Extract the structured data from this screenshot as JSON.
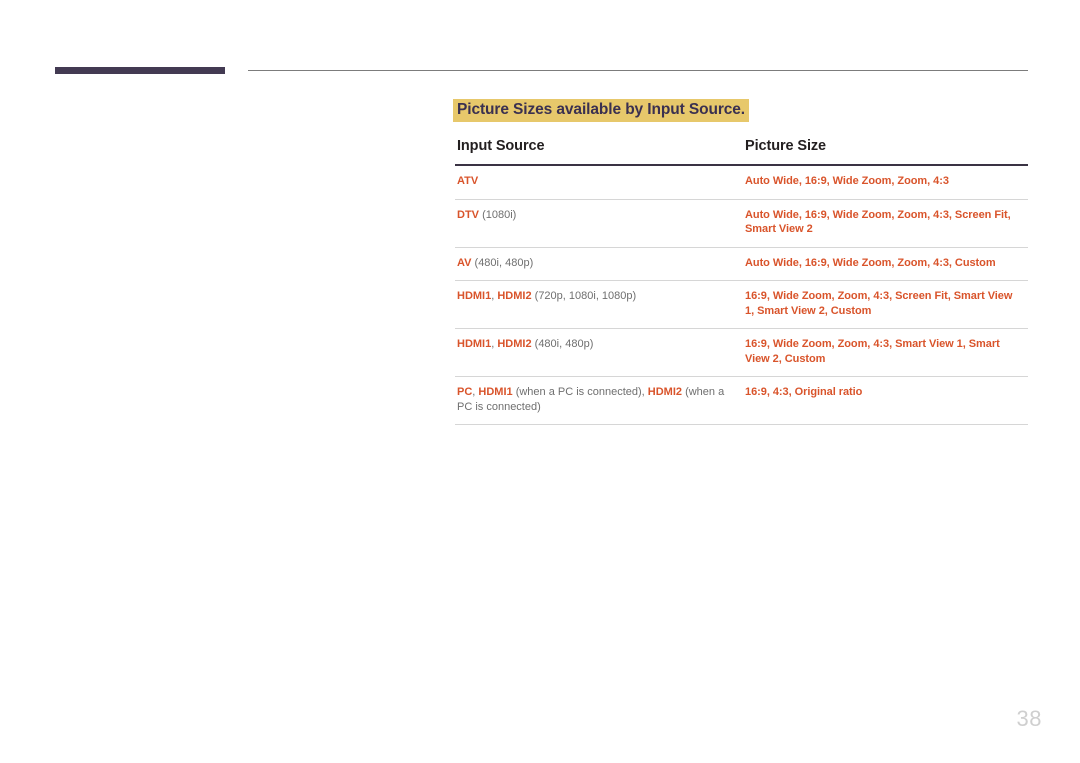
{
  "page": {
    "number": "38",
    "accent_highlight": "#e7c86b",
    "accent_title_text": "#3a3050",
    "accent_orange": "#d9542b",
    "rule_dark": "#433a52",
    "rule_light": "#7c7c7c"
  },
  "section": {
    "title": "Picture Sizes available by Input Source."
  },
  "table": {
    "headers": {
      "input_source": "Input Source",
      "picture_size": "Picture Size"
    },
    "rows": [
      {
        "id": "atv",
        "source_main": "ATV",
        "source_note": "",
        "source_main2": "",
        "source_note2": "",
        "sizes": "Auto Wide, 16:9, Wide Zoom, Zoom, 4:3"
      },
      {
        "id": "dtv",
        "source_main": "DTV",
        "source_note": "(1080i)",
        "source_main2": "",
        "source_note2": "",
        "sizes": "Auto Wide, 16:9, Wide Zoom, Zoom, 4:3, Screen Fit, Smart View 2"
      },
      {
        "id": "av",
        "source_main": "AV",
        "source_note": "(480i, 480p)",
        "source_main2": "",
        "source_note2": "",
        "sizes": "Auto Wide, 16:9, Wide Zoom, Zoom, 4:3, Custom"
      },
      {
        "id": "hdmi-hd",
        "source_main": "HDMI1",
        "source_sep": ", ",
        "source_main2": "HDMI2",
        "source_note2": "(720p, 1080i, 1080p)",
        "sizes": "16:9, Wide Zoom, Zoom, 4:3, Screen Fit, Smart View 1, Smart View 2, Custom"
      },
      {
        "id": "hdmi-sd",
        "source_main": "HDMI1",
        "source_sep": ", ",
        "source_main2": "HDMI2",
        "source_note2": "(480i, 480p)",
        "sizes": "16:9, Wide Zoom, Zoom, 4:3, Smart View 1, Smart View 2, Custom"
      },
      {
        "id": "pc",
        "source_main": "PC",
        "source_sep": ", ",
        "source_main2": "HDMI1",
        "source_note2": "(when a PC is connected), ",
        "source_main3": "HDMI2",
        "source_note3": "(when a PC is connected)",
        "sizes": "16:9, 4:3, Original ratio"
      }
    ]
  }
}
